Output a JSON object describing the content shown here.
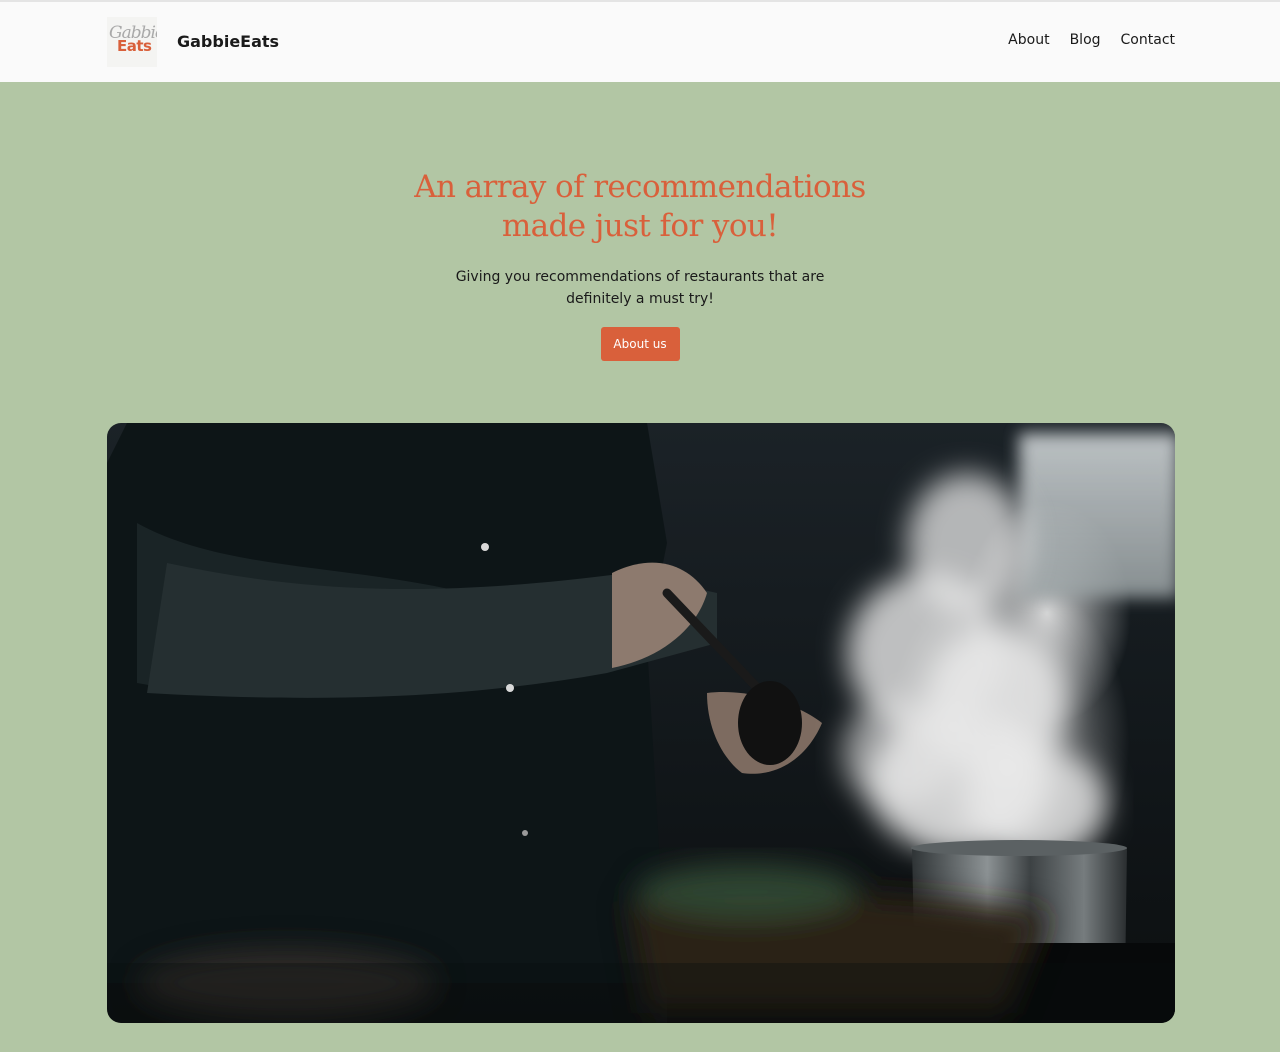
{
  "header": {
    "logo_script": "Gabbie",
    "logo_eats": "Eats",
    "brand": "GabbieEats",
    "nav": [
      "About",
      "Blog",
      "Contact"
    ]
  },
  "hero": {
    "title_line1": "An array of recommendations",
    "title_line2": "made just for you!",
    "subtitle": "Giving you recommendations of restaurants that are definitely a must try!",
    "cta": "About us"
  },
  "image": {
    "subject": "chef-cooking-with-steaming-pot"
  },
  "colors": {
    "background": "#b2c6a4",
    "accent": "#d9603b",
    "header": "#fafafa"
  }
}
